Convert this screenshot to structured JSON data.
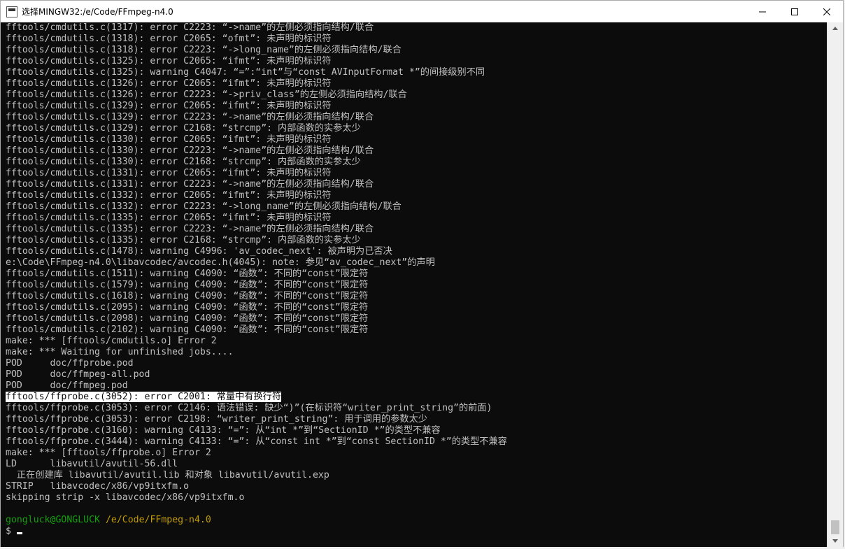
{
  "window": {
    "title": "选择MINGW32:/e/Code/FFmpeg-n4.0",
    "minimize_label": "minimize",
    "maximize_label": "maximize",
    "close_label": "close"
  },
  "terminal": {
    "lines": [
      "fftools/cmdutils.c(1317): error C2223: “->name”的左侧必须指向结构/联合",
      "fftools/cmdutils.c(1318): error C2065: “ofmt”: 未声明的标识符",
      "fftools/cmdutils.c(1318): error C2223: “->long_name”的左侧必须指向结构/联合",
      "fftools/cmdutils.c(1325): error C2065: “ifmt”: 未声明的标识符",
      "fftools/cmdutils.c(1325): warning C4047: “=”:“int”与“const AVInputFormat *”的间接级别不同",
      "fftools/cmdutils.c(1326): error C2065: “ifmt”: 未声明的标识符",
      "fftools/cmdutils.c(1326): error C2223: “->priv_class”的左侧必须指向结构/联合",
      "fftools/cmdutils.c(1329): error C2065: “ifmt”: 未声明的标识符",
      "fftools/cmdutils.c(1329): error C2223: “->name”的左侧必须指向结构/联合",
      "fftools/cmdutils.c(1329): error C2168: “strcmp”: 内部函数的实参太少",
      "fftools/cmdutils.c(1330): error C2065: “ifmt”: 未声明的标识符",
      "fftools/cmdutils.c(1330): error C2223: “->name”的左侧必须指向结构/联合",
      "fftools/cmdutils.c(1330): error C2168: “strcmp”: 内部函数的实参太少",
      "fftools/cmdutils.c(1331): error C2065: “ifmt”: 未声明的标识符",
      "fftools/cmdutils.c(1331): error C2223: “->name”的左侧必须指向结构/联合",
      "fftools/cmdutils.c(1332): error C2065: “ifmt”: 未声明的标识符",
      "fftools/cmdutils.c(1332): error C2223: “->long_name”的左侧必须指向结构/联合",
      "fftools/cmdutils.c(1335): error C2065: “ifmt”: 未声明的标识符",
      "fftools/cmdutils.c(1335): error C2223: “->name”的左侧必须指向结构/联合",
      "fftools/cmdutils.c(1335): error C2168: “strcmp”: 内部函数的实参太少",
      "fftools/cmdutils.c(1478): warning C4996: 'av_codec_next': 被声明为已否决",
      "e:\\Code\\FFmpeg-n4.0\\libavcodec/avcodec.h(4045): note: 参见“av_codec_next”的声明",
      "fftools/cmdutils.c(1511): warning C4090: “函数”: 不同的“const”限定符",
      "fftools/cmdutils.c(1579): warning C4090: “函数”: 不同的“const”限定符",
      "fftools/cmdutils.c(1618): warning C4090: “函数”: 不同的“const”限定符",
      "fftools/cmdutils.c(2095): warning C4090: “函数”: 不同的“const”限定符",
      "fftools/cmdutils.c(2098): warning C4090: “函数”: 不同的“const”限定符",
      "fftools/cmdutils.c(2102): warning C4090: “函数”: 不同的“const”限定符",
      "make: *** [fftools/cmdutils.o] Error 2",
      "make: *** Waiting for unfinished jobs....",
      "POD     doc/ffprobe.pod",
      "POD     doc/ffmpeg-all.pod",
      "POD     doc/ffmpeg.pod",
      "fftools/ffprobe.c(3052): error C2001: 常量中有换行符",
      "fftools/ffprobe.c(3053): error C2146: 语法错误: 缺少“)”(在标识符“writer_print_string”的前面)",
      "fftools/ffprobe.c(3053): error C2198: “writer_print_string”: 用于调用的参数太少",
      "fftools/ffprobe.c(3160): warning C4133: “=”: 从“int *”到“SectionID *”的类型不兼容",
      "fftools/ffprobe.c(3444): warning C4133: “=”: 从“const int *”到“const SectionID *”的类型不兼容",
      "make: *** [fftools/ffprobe.o] Error 2",
      "LD      libavutil/avutil-56.dll",
      "  正在创建库 libavutil/avutil.lib 和对象 libavutil/avutil.exp",
      "STRIP   libavcodec/x86/vp9itxfm.o",
      "skipping strip -x libavcodec/x86/vp9itxfm.o",
      ""
    ],
    "selected_line_index": 33,
    "prompt_user": "gongluck@GONGLUCK",
    "prompt_path": "/e/Code/FFmpeg-n4.0",
    "prompt_symbol": "$"
  },
  "colors": {
    "background": "#0c0c0c",
    "text": "#c0c0c0",
    "prompt_user": "#13a10e",
    "prompt_path": "#c19c00"
  }
}
